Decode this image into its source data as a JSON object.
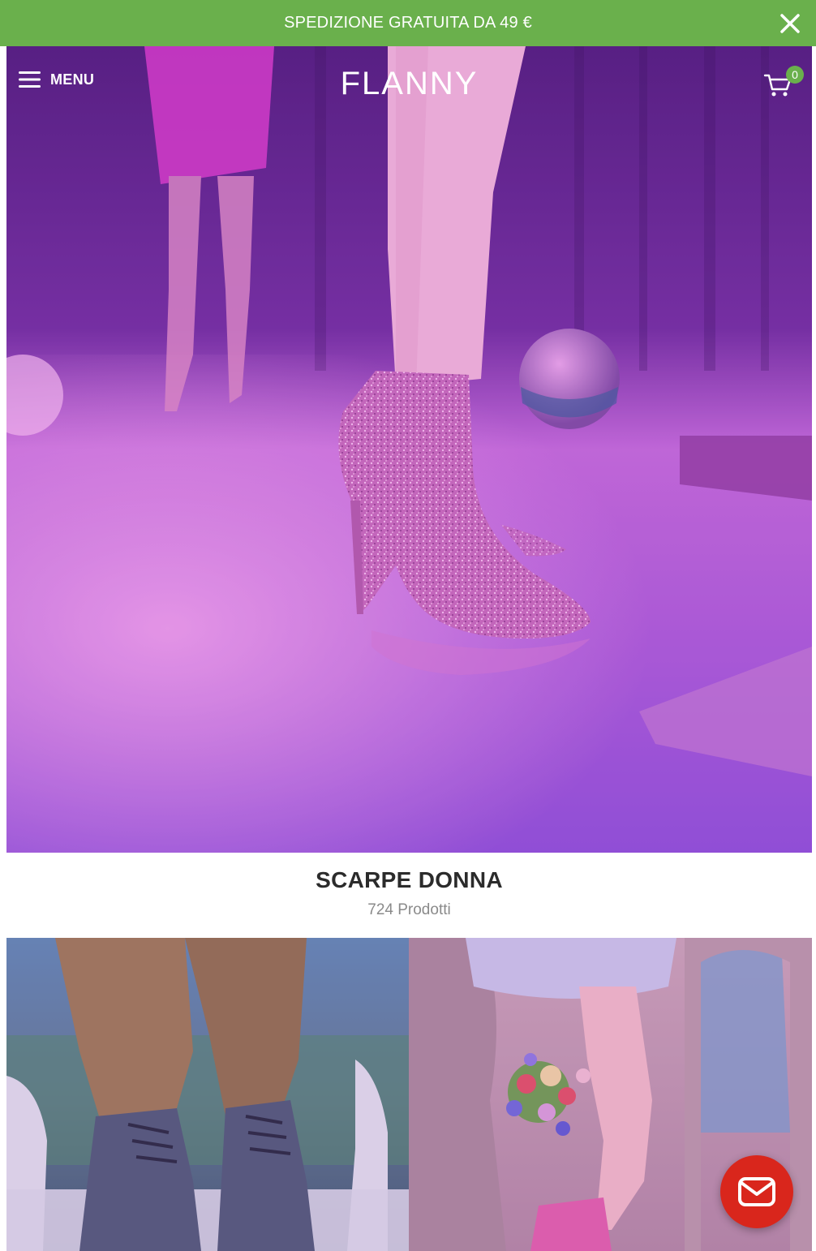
{
  "colors": {
    "promo_bg": "#6ab04c",
    "badge_bg": "#6ab04c",
    "chat_bg": "#d9261c",
    "hero_tint": "#c04ad8"
  },
  "promo": {
    "text": "SPEDIZIONE GRATUITA DA 49 €",
    "close_icon": "close-icon"
  },
  "header": {
    "menu_icon": "hamburger-icon",
    "menu_label": "MENU",
    "logo": "FLANNY",
    "cart_icon": "cart-icon",
    "cart_count": "0"
  },
  "category": {
    "title": "SCARPE DONNA",
    "count": "724 Prodotti"
  },
  "chat": {
    "icon": "mail-icon"
  }
}
